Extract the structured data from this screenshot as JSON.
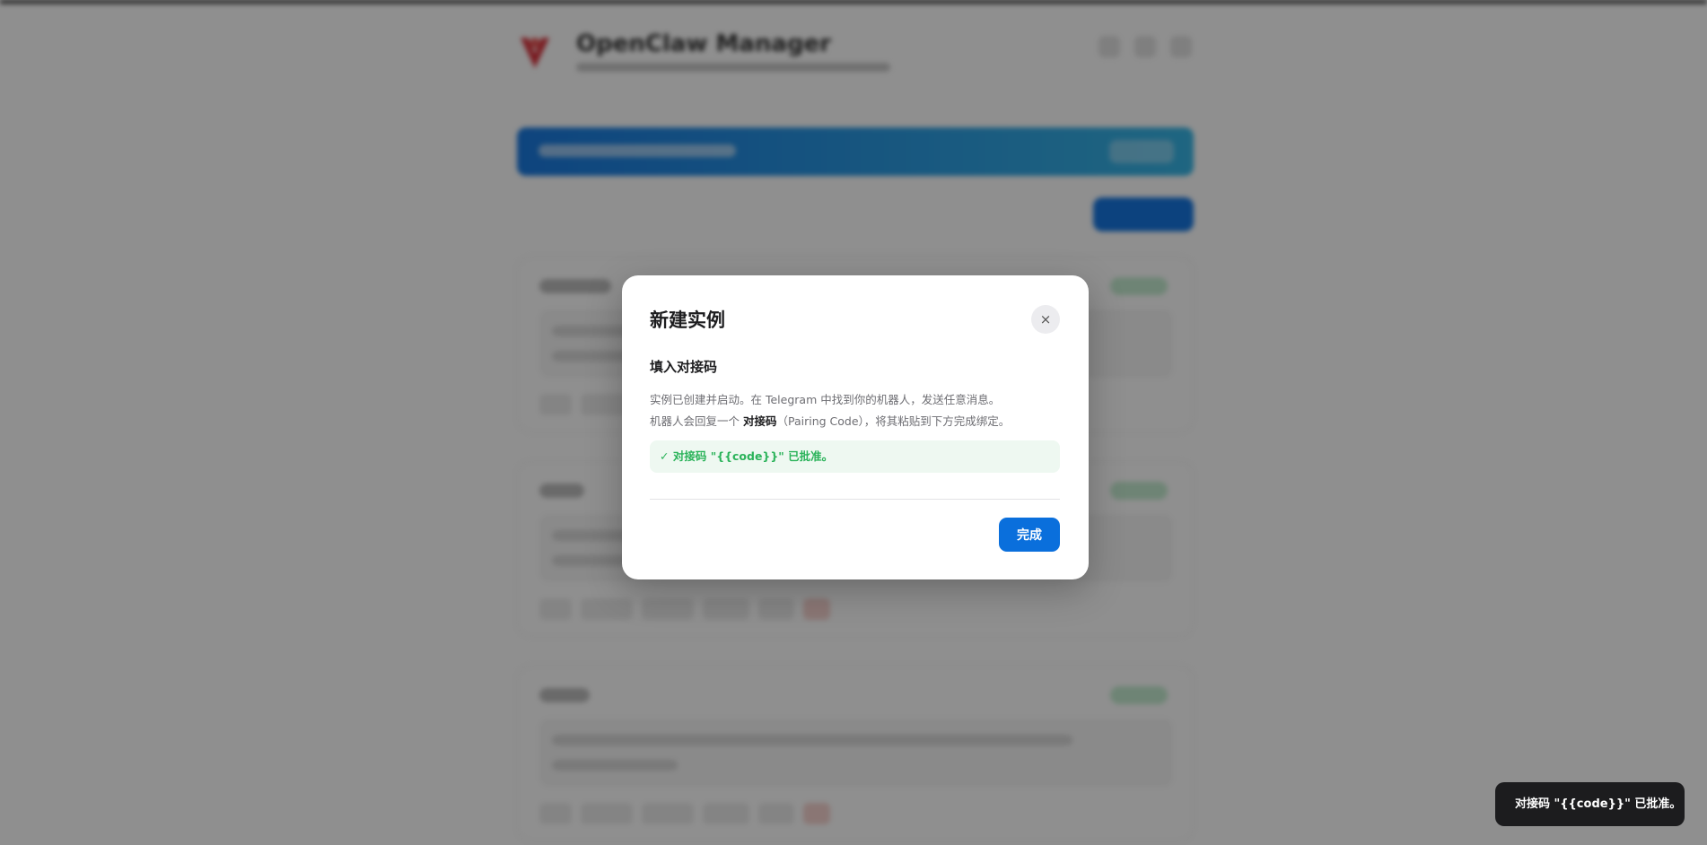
{
  "background": {
    "app_title": "OpenClaw Manager"
  },
  "modal": {
    "title": "新建实例",
    "close_label": "×",
    "step_title": "填入对接码",
    "desc_line1": "实例已创建并启动。在 Telegram 中找到你的机器人，发送任意消息。",
    "desc_line2_prefix": "机器人会回复一个 ",
    "desc_line2_bold": "对接码",
    "desc_line2_suffix": "（Pairing Code），将其粘贴到下方完成绑定。",
    "success_icon": "✓",
    "success_text": "对接码 \"{{code}}\" 已批准。",
    "done_label": "完成"
  },
  "toast": {
    "text": "对接码 \"{{code}}\" 已批准。"
  },
  "colors": {
    "primary": "#0a6fdc",
    "success": "#2bb35a",
    "success_bg": "#eef8f1",
    "toast_bg": "#1c1c1e"
  }
}
